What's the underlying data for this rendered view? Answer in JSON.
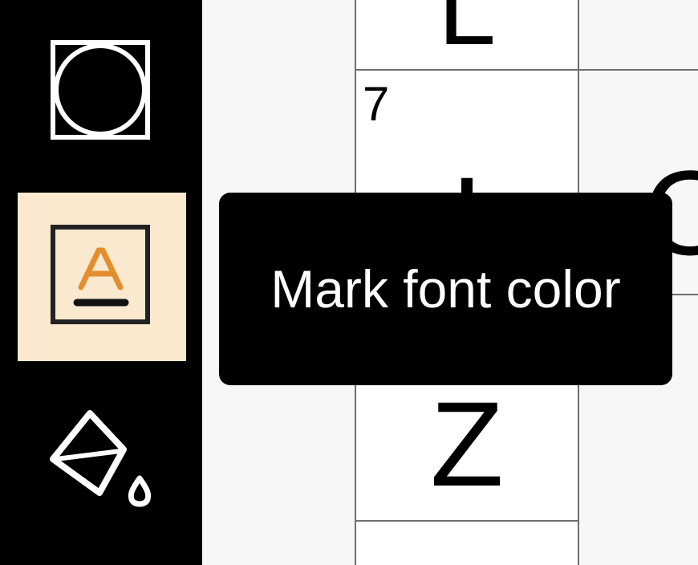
{
  "toolbar": {
    "tools": [
      {
        "name": "circle-tool",
        "icon": "circle-in-square-icon"
      },
      {
        "name": "font-color-tool",
        "icon": "font-color-a-icon",
        "active": true,
        "icon_color": "#e38e2e"
      },
      {
        "name": "fill-color-tool",
        "icon": "paint-bucket-icon"
      }
    ]
  },
  "grid": {
    "cells": [
      {
        "letter": "L",
        "number": ""
      },
      {
        "letter": "I",
        "number": "7"
      },
      {
        "letter": "Z",
        "number": ""
      }
    ],
    "neighbor_letter": "O"
  },
  "tooltip": {
    "text": "Mark font color"
  },
  "colors": {
    "toolbar_bg": "#000000",
    "active_bg": "#fae8cf",
    "accent_orange": "#e38e2e",
    "grid_line": "#6e6e6e"
  }
}
